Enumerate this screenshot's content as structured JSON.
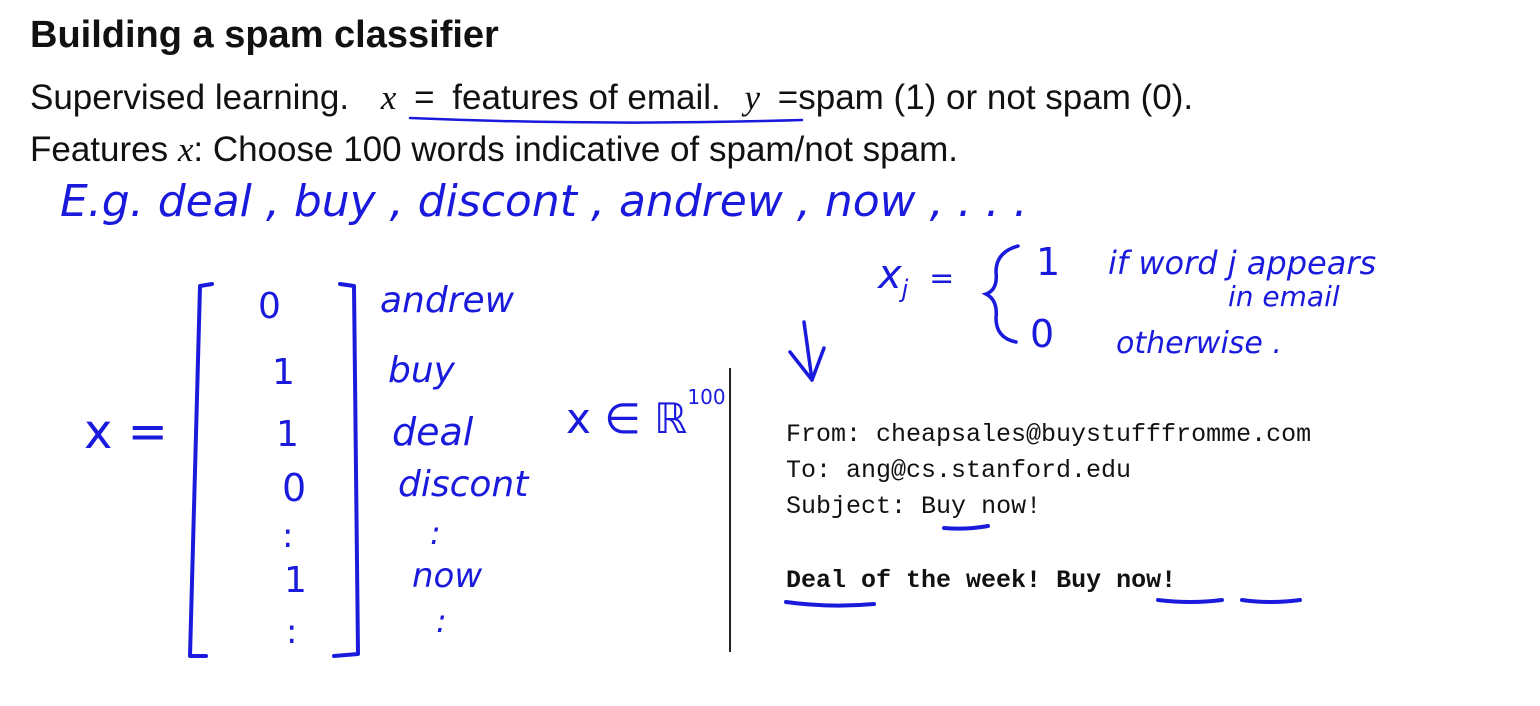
{
  "slide": {
    "title": "Building a spam classifier",
    "line1": {
      "prefix": "Supervised learning.",
      "x_var": "x",
      "eq1": "=",
      "features": "features of email.",
      "y_var": "y",
      "eq2": "=",
      "rest": "spam (1) or not spam (0)."
    },
    "line2": {
      "prefix": "Features",
      "x_var": "x",
      "rest": ": Choose 100 words indicative of spam/not spam."
    }
  },
  "handwriting": {
    "examples": "E.g. deal , buy , discont , andrew , now , . . .",
    "x_label": "x =",
    "vector_values": [
      "0",
      "1",
      "1",
      "0",
      ":",
      "1",
      ":"
    ],
    "vector_words": [
      "andrew",
      "buy",
      "deal",
      "discont",
      ":",
      "now",
      ":"
    ],
    "membership": "x ∈ ℝ",
    "membership_sup": "100",
    "xj_def": {
      "lhs": "x",
      "sub": "j",
      "eq": "=",
      "case1_value": "1",
      "case1_text": "if   word j appears",
      "case1_text2": "in email",
      "case2_value": "0",
      "case2_text": "otherwise ."
    },
    "arrow": "↓"
  },
  "email": {
    "from": "From: cheapsales@buystufffromme.com",
    "to": "To: ang@cs.stanford.edu",
    "subject_label": "Subject:",
    "subject_word1": "Buy",
    "subject_rest": "now!",
    "body_word1": "Deal",
    "body_mid": "of the week!",
    "body_word2": "Buy",
    "body_word3": "now!"
  },
  "colors": {
    "ink": "#1a1adc",
    "text": "#111111",
    "background": "#ffffff"
  }
}
